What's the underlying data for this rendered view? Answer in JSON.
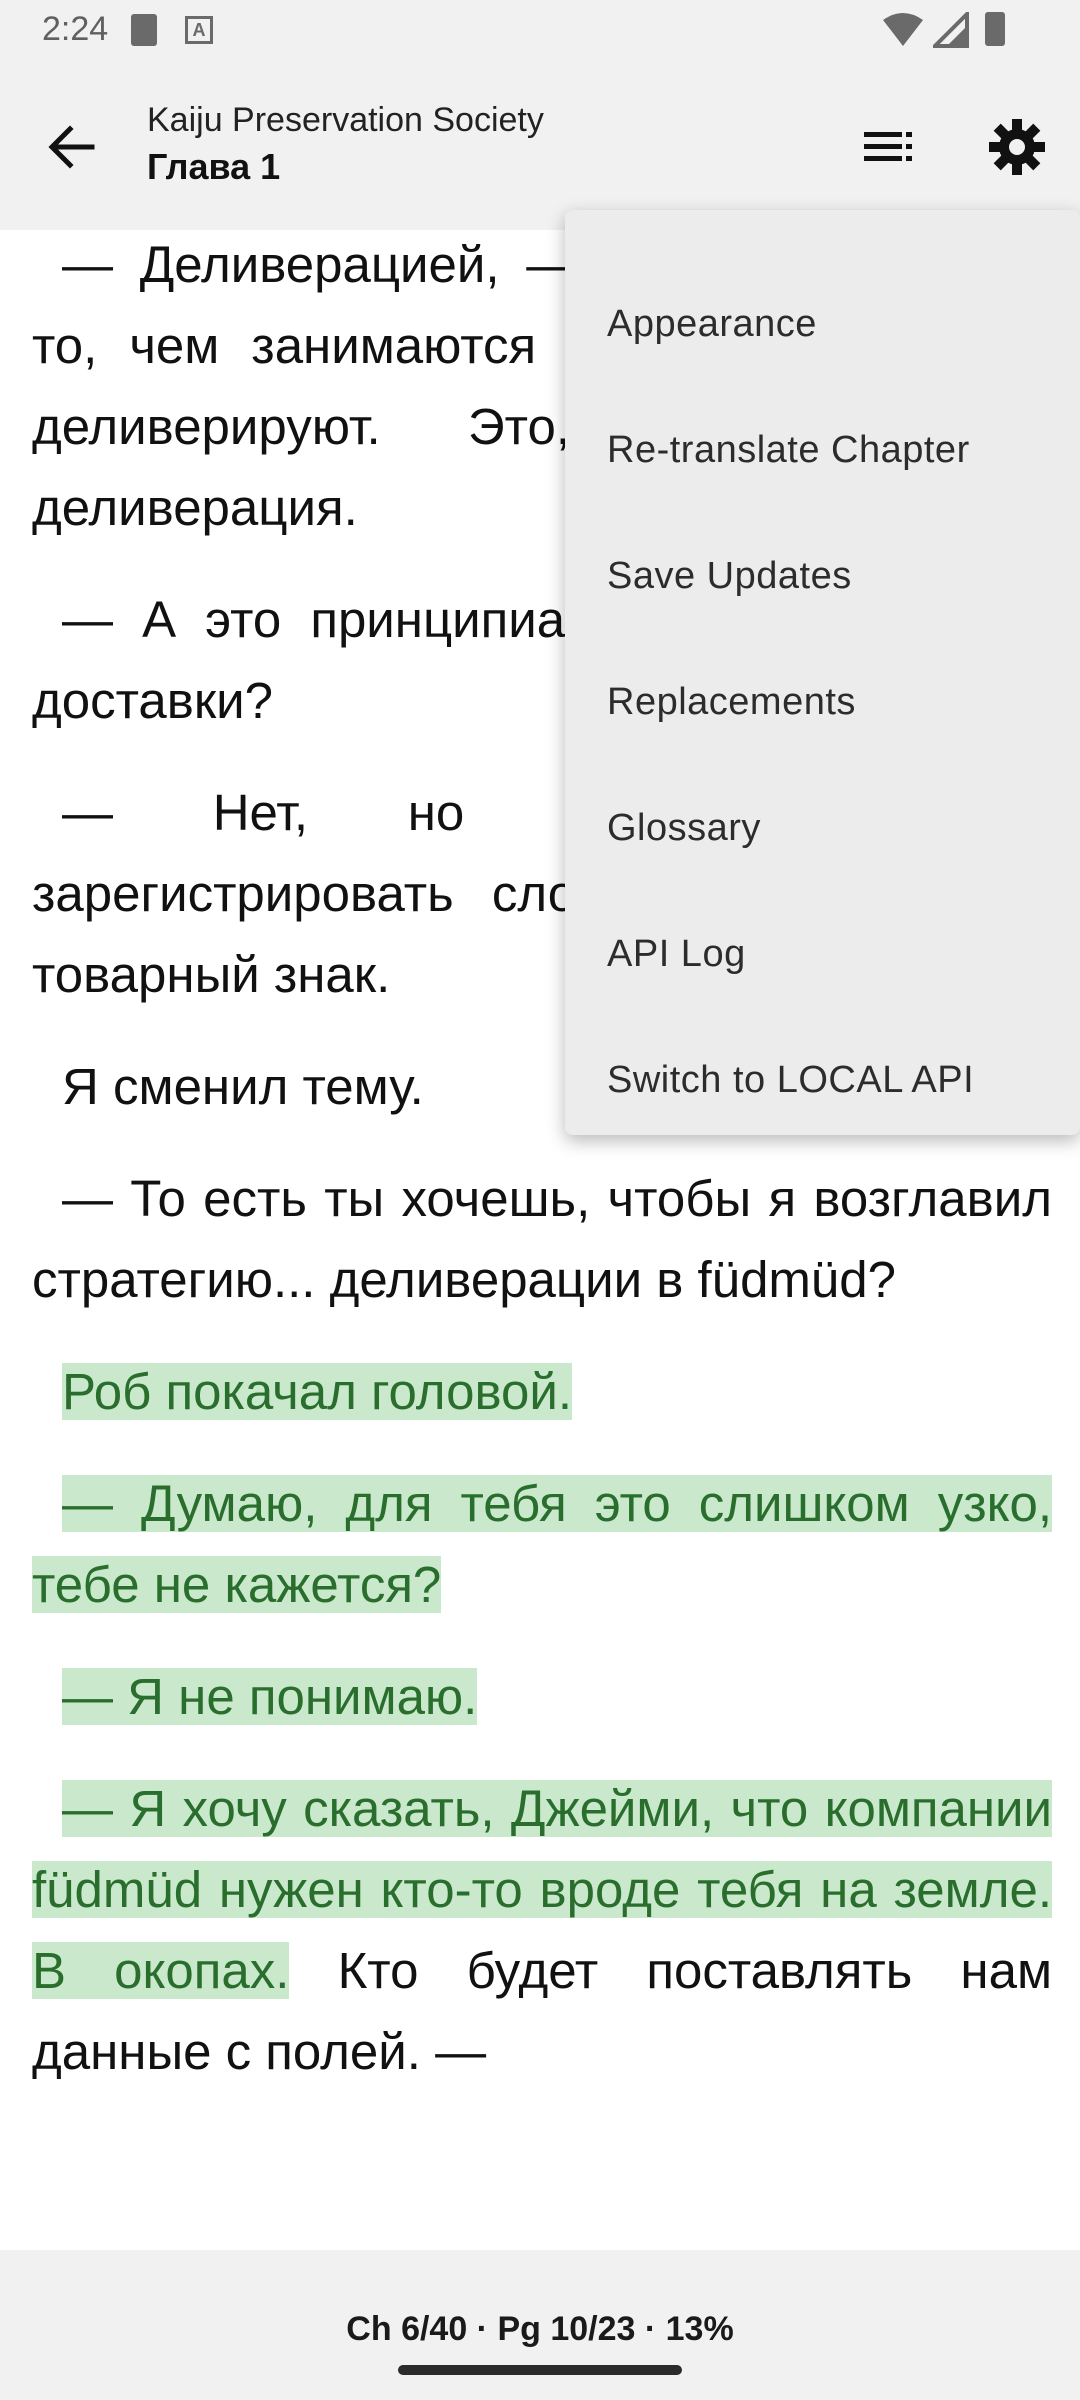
{
  "status_bar": {
    "time": "2:24",
    "sd_icon": "sd-card-icon",
    "a_icon": "A"
  },
  "app_bar": {
    "book_title": "Kaiju Preservation Society",
    "chapter_title": "Глава 1",
    "back_icon": "arrow-left-icon",
    "toc_icon": "chapter-list-icon",
    "settings_icon": "gear-icon"
  },
  "content": {
    "paragraphs": [
      {
        "segments": [
          {
            "text": "— Деливерацией, — сказал он. — Это то, чем занимаются деливераторы. Они деливерируют. Это, должно быть, деливерация.",
            "highlight": false
          }
        ]
      },
      {
        "segments": [
          {
            "text": "— А это принципиально отличается от доставки?",
            "highlight": false
          }
        ]
      },
      {
        "segments": [
          {
            "text": "— Нет, но мы не можем зарегистрировать слово «доставка» как товарный знак.",
            "highlight": false
          }
        ]
      },
      {
        "segments": [
          {
            "text": "Я сменил тему.",
            "highlight": false
          }
        ]
      },
      {
        "segments": [
          {
            "text": "— То есть ты хочешь, чтобы я возглавил стратегию... деливерации в füdmüd?",
            "highlight": false
          }
        ]
      },
      {
        "segments": [
          {
            "text": "Роб покачал головой.",
            "highlight": true
          }
        ]
      },
      {
        "segments": [
          {
            "text": "— Думаю, для тебя это слишком узко, тебе не кажется?",
            "highlight": true
          }
        ]
      },
      {
        "segments": [
          {
            "text": "— Я не понимаю.",
            "highlight": true
          }
        ]
      },
      {
        "segments": [
          {
            "text": "— Я хочу сказать, Джейми, что компании füdmüd нужен кто-то вроде тебя на земле. В окопах.",
            "highlight": true
          },
          {
            "text": " Кто будет поставлять нам данные с полей. — ",
            "highlight": false
          }
        ]
      }
    ]
  },
  "menu": {
    "items": [
      "Appearance",
      "Re-translate Chapter",
      "Save Updates",
      "Replacements",
      "Glossary",
      "API Log",
      "Switch to LOCAL API"
    ]
  },
  "bottom_bar": {
    "progress": "Ch 6/40 · Pg 10/23 · 13%"
  },
  "colors": {
    "highlight_bg": "#c9e8cc",
    "highlight_text": "#2a6e2e",
    "menu_bg": "#ececec",
    "bar_bg": "#f1f1f1"
  }
}
